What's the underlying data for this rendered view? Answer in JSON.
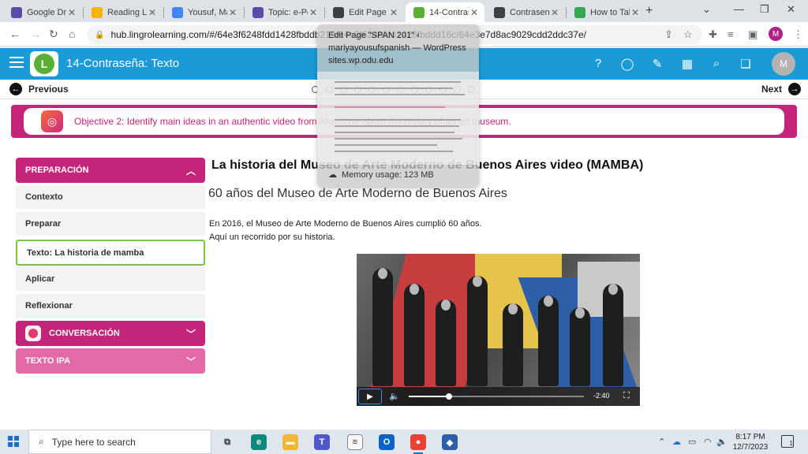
{
  "browser": {
    "tabs": [
      {
        "label": "Google Dri",
        "icon": "crown-icon",
        "color": "#5b4ba8",
        "active": false
      },
      {
        "label": "Reading Lo",
        "icon": "drive-icon",
        "color": "#f4b400",
        "active": false
      },
      {
        "label": "Yousuf, Ma",
        "icon": "docs-icon",
        "color": "#4285f4",
        "active": false
      },
      {
        "label": "Topic: e-Po",
        "icon": "crown-icon",
        "color": "#5b4ba8",
        "active": false
      },
      {
        "label": "Edit Page \"",
        "icon": "wordpress-icon",
        "color": "#3c4043",
        "active": false
      },
      {
        "label": "14-Contras",
        "icon": "lingro-icon",
        "color": "#5ab034",
        "active": true
      },
      {
        "label": "Contrasen",
        "icon": "wordpress-icon",
        "color": "#3c4043",
        "active": false
      },
      {
        "label": "How to Tal",
        "icon": "video-icon",
        "color": "#34a853",
        "active": false
      }
    ],
    "url": "hub.lingrolearning.com/#/64e3f6248fdd1428fbddb219/64e3f6248fdd1428fbddd16c/64e3e7d8ac9029cdd2ddc37e/",
    "profile_initial": "M"
  },
  "app": {
    "title": "14-Contraseña: Texto",
    "avatar_initial": "M",
    "previous_label": "Previous",
    "next_label": "Next",
    "objective": "Objective 2: Identify main ideas in an authentic video from Argentina about the history of an art museum."
  },
  "sidebar": {
    "preparacion": "PREPARACIÓN",
    "items": [
      {
        "label": "Contexto"
      },
      {
        "label": "Preparar"
      },
      {
        "label": "Texto: La historia de mamba"
      },
      {
        "label": "Aplicar"
      },
      {
        "label": "Reflexionar"
      }
    ],
    "conversacion": "CONVERSACIÓN",
    "texto_ipa": "TEXTO IPA",
    "colors": {
      "preparacion": "#c4257a",
      "conversacion": "#c4257a",
      "texto_ipa": "#e36aa6",
      "active_border": "#7bc143"
    }
  },
  "content": {
    "title": "La historia del Museo de Arte Moderno de Buenos Aires video (MAMBA)",
    "subtitle": "60 años del Museo de Arte Moderno de Buenos Aires",
    "paragraph_line1": "En 2016, el Museo de Arte Moderno de Buenos Aires cumplió 60 años.",
    "paragraph_line2": "Aquí un recorrido por su historia.",
    "video": {
      "time_remaining": "-2:40",
      "progress": 0.23
    }
  },
  "tooltip": {
    "title": "Edit Page \"SPAN 201\" ‹ mariyayousufspanish — WordPress",
    "domain": "sites.wp.odu.edu",
    "memory": "Memory usage: 123 MB"
  },
  "taskbar": {
    "search_placeholder": "Type here to search",
    "time": "8:17 PM",
    "date": "12/7/2023",
    "notification_count": "1"
  }
}
